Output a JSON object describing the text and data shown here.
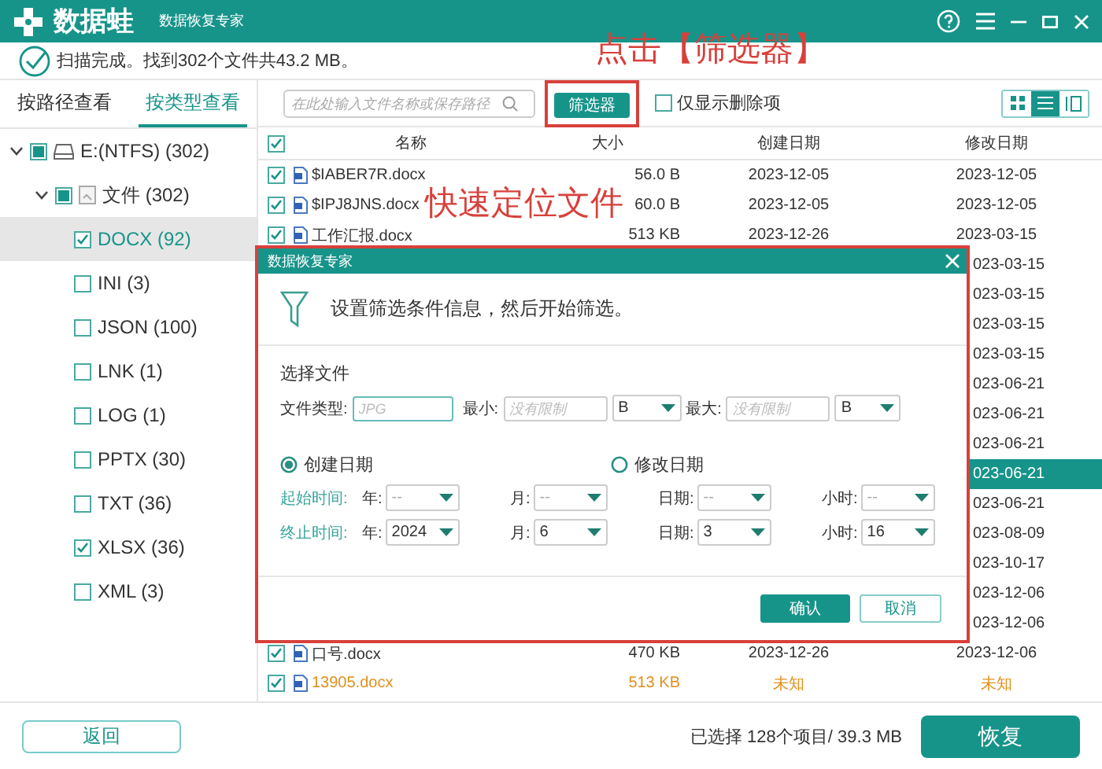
{
  "app": {
    "logo": "数据蛙",
    "subtitle": "数据恢复专家"
  },
  "scan_status": "扫描完成。找到302个文件共43.2 MB。",
  "annotations": [
    "点击【筛选器】",
    "快速定位文件"
  ],
  "sidebar": {
    "tabs": [
      {
        "label": "按路径查看",
        "selected": false
      },
      {
        "label": "按类型查看",
        "selected": true
      }
    ],
    "tree": [
      {
        "label": "E:(NTFS) (302)",
        "kind": "drive",
        "checked": false,
        "partial": true,
        "expanded": true,
        "selected": false,
        "children": [
          {
            "label": "文件 (302)",
            "kind": "folder",
            "checked": false,
            "partial": true,
            "expanded": true,
            "selected": false,
            "children": [
              {
                "label": "DOCX (92)",
                "checked": true,
                "selected": true
              },
              {
                "label": "INI (3)",
                "checked": false,
                "selected": false
              },
              {
                "label": "JSON (100)",
                "checked": false,
                "selected": false
              },
              {
                "label": "LNK (1)",
                "checked": false,
                "selected": false
              },
              {
                "label": "LOG (1)",
                "checked": false,
                "selected": false
              },
              {
                "label": "PPTX (30)",
                "checked": false,
                "selected": false
              },
              {
                "label": "TXT (36)",
                "checked": false,
                "selected": false
              },
              {
                "label": "XLSX (36)",
                "checked": true,
                "selected": false
              },
              {
                "label": "XML (3)",
                "checked": false,
                "selected": false
              }
            ]
          }
        ]
      }
    ]
  },
  "toolbar": {
    "search": {
      "placeholder": "在此处输入文件名称或保存路径"
    },
    "filter_button": {
      "label": "筛选器",
      "highlighted": true
    },
    "deleted_only": {
      "label": "仅显示删除项",
      "checked": false
    },
    "view_modes": [
      {
        "kind": "grid",
        "selected": false
      },
      {
        "kind": "list",
        "selected": true
      },
      {
        "kind": "columns",
        "selected": false
      }
    ]
  },
  "table": {
    "header_checked": true,
    "columns": [
      "名称",
      "大小",
      "创建日期",
      "修改日期"
    ],
    "rows": [
      {
        "checked": true,
        "name": "$IABER7R.docx",
        "size": "56.0  B",
        "created": "2023-12-05",
        "modified": "2023-12-05",
        "selected": false,
        "kind": "normal"
      },
      {
        "checked": true,
        "name": "$IPJ8JNS.docx",
        "size": "60.0  B",
        "created": "2023-12-05",
        "modified": "2023-12-05",
        "selected": false,
        "kind": "normal"
      },
      {
        "checked": true,
        "name": "工作汇报.docx",
        "size": "513 KB",
        "created": "2023-12-26",
        "modified": "2023-03-15",
        "selected": false,
        "kind": "normal"
      },
      {
        "modified": "023-03-15",
        "selected": false,
        "kind": "normal"
      },
      {
        "modified": "023-03-15",
        "selected": false,
        "kind": "normal"
      },
      {
        "modified": "023-03-15",
        "selected": false,
        "kind": "normal"
      },
      {
        "modified": "023-03-15",
        "selected": false,
        "kind": "normal"
      },
      {
        "modified": "023-06-21",
        "selected": false,
        "kind": "normal"
      },
      {
        "modified": "023-06-21",
        "selected": false,
        "kind": "normal"
      },
      {
        "modified": "023-06-21",
        "selected": false,
        "kind": "normal"
      },
      {
        "modified": "023-06-21",
        "selected": true,
        "kind": "normal"
      },
      {
        "modified": "023-06-21",
        "selected": false,
        "kind": "normal"
      },
      {
        "modified": "023-08-09",
        "selected": false,
        "kind": "normal"
      },
      {
        "modified": "023-10-17",
        "selected": false,
        "kind": "normal"
      },
      {
        "modified": "023-12-06",
        "selected": false,
        "kind": "normal"
      },
      {
        "modified": "023-12-06",
        "selected": false,
        "kind": "normal"
      },
      {
        "checked": true,
        "name": "口号.docx",
        "size": "470 KB",
        "created": "2023-12-26",
        "modified": "2023-12-06",
        "selected": false,
        "kind": "normal"
      },
      {
        "checked": true,
        "name": "13905.docx",
        "size": "513 KB",
        "created": "未知",
        "modified": "未知",
        "selected": false,
        "kind": "unknown"
      }
    ]
  },
  "dialog": {
    "title": "数据恢复专家",
    "highlighted": true,
    "hint": "设置筛选条件信息，然后开始筛选。",
    "section": "选择文件",
    "file_type": {
      "label": "文件类型:",
      "placeholder": "JPG"
    },
    "min": {
      "label": "最小:",
      "placeholder": "没有限制",
      "unit": "B"
    },
    "max": {
      "label": "最大:",
      "placeholder": "没有限制",
      "unit": "B"
    },
    "date_modes": [
      {
        "label": "创建日期",
        "selected": true
      },
      {
        "label": "修改日期",
        "selected": false
      }
    ],
    "time_rows": [
      {
        "label": "起始时间:",
        "fields": [
          {
            "label": "年:",
            "value": "--"
          },
          {
            "label": "月:",
            "value": "--"
          },
          {
            "label": "日期:",
            "value": "--"
          },
          {
            "label": "小时:",
            "value": "--"
          }
        ]
      },
      {
        "label": "终止时间:",
        "fields": [
          {
            "label": "年:",
            "value": "2024"
          },
          {
            "label": "月:",
            "value": "6"
          },
          {
            "label": "日期:",
            "value": "3"
          },
          {
            "label": "小时:",
            "value": "16"
          }
        ]
      }
    ],
    "buttons": [
      {
        "label": "确认",
        "kind": "primary"
      },
      {
        "label": "取消",
        "kind": "secondary"
      }
    ]
  },
  "footer": {
    "back_button": "返回",
    "selection": "已选择 128个项目/ 39.3 MB",
    "recover_button": "恢复"
  }
}
